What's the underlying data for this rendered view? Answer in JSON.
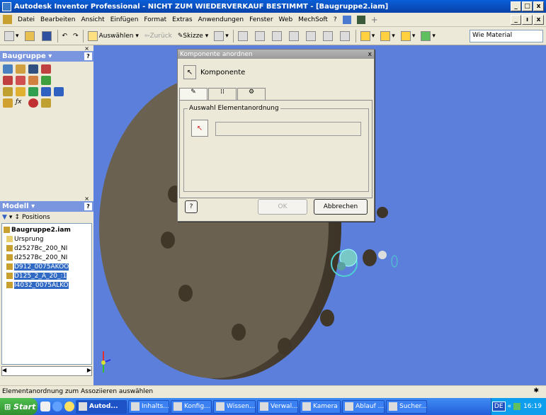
{
  "window": {
    "title": "Autodesk Inventor Professional - NICHT ZUM WIEDERVERKAUF BESTIMMT - [Baugruppe2.iam]",
    "buttons": [
      "_",
      "□",
      "x"
    ],
    "doc_buttons": [
      "_",
      "ı",
      "x"
    ]
  },
  "menu": [
    "Datei",
    "Bearbeiten",
    "Ansicht",
    "Einfügen",
    "Format",
    "Extras",
    "Anwendungen",
    "Fenster",
    "Web",
    "MechSoft",
    "?"
  ],
  "toolbar": {
    "auswaehlen": "Auswählen",
    "zurueck": "Zurück",
    "skizze": "Skizze",
    "material": "Wie Material"
  },
  "panels": {
    "baugruppe_title": "Baugruppe",
    "modell_title": "Modell",
    "positions_label": "Positions",
    "help": "?"
  },
  "tree": [
    {
      "label": "Baugruppe2.iam",
      "selected": false,
      "bold": true
    },
    {
      "label": "Ursprung",
      "selected": false
    },
    {
      "label": "d2527Bc_200_NI",
      "selected": false
    },
    {
      "label": "d2527Bc_200_NI",
      "selected": false
    },
    {
      "label": "D912_0075AKOO",
      "selected": true
    },
    {
      "label": "D125_2_A_20_:1",
      "selected": true
    },
    {
      "label": "I4032_0075ALKO",
      "selected": true
    }
  ],
  "dialog": {
    "title": "Komponente anordnen",
    "close": "x",
    "komponente_label": "Komponente",
    "group_label": "Auswahl Elementanordnung",
    "ok": "OK",
    "abbrechen": "Abbrechen",
    "help": "?"
  },
  "status": {
    "text": "Elementanordnung zum Assoziieren auswählen"
  },
  "taskbar": {
    "start": "Start",
    "tasks": [
      {
        "label": "Autod...",
        "active": true
      },
      {
        "label": "Inhalts...",
        "active": false
      },
      {
        "label": "Konfig...",
        "active": false
      },
      {
        "label": "Wissen...",
        "active": false
      },
      {
        "label": "Verwal...",
        "active": false
      },
      {
        "label": "Kamera",
        "active": false
      },
      {
        "label": "Ablauf ...",
        "active": false
      },
      {
        "label": "Sucher...",
        "active": false
      }
    ],
    "lang": "DE",
    "clock": "16:19"
  }
}
